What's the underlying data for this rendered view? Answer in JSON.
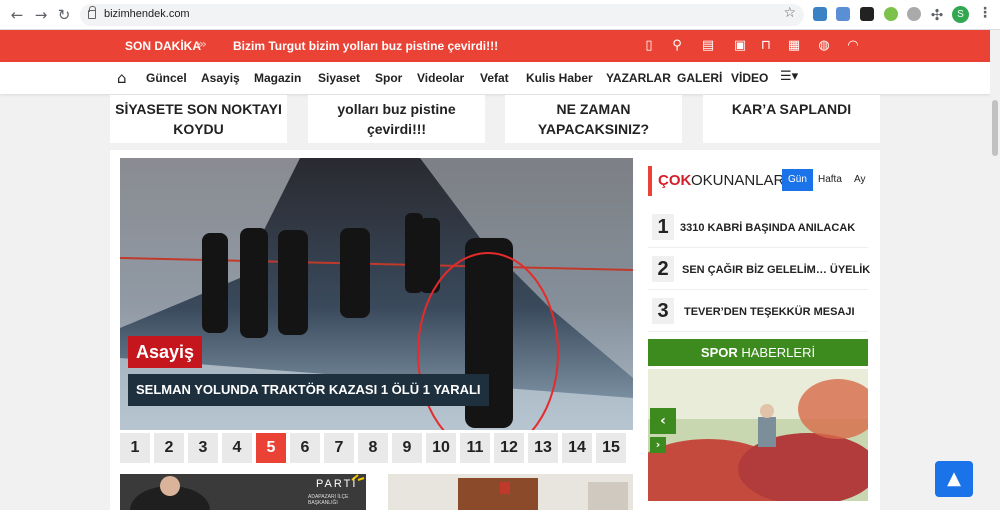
{
  "browser": {
    "url": "bizimhendek.com",
    "profile_initial": "S",
    "icons": [
      "back-icon",
      "forward-icon",
      "reload-icon",
      "lock-icon",
      "star-icon",
      "extension-icons",
      "puzzle-icon",
      "menu-dots-icon"
    ]
  },
  "ticker": {
    "label": "SON DAKİKA",
    "arrows": "›››",
    "headline": "Bizim Turgut bizim yolları buz pistine çevirdi!!!",
    "icons": [
      "mobile-icon",
      "search-icon",
      "id-card-icon",
      "briefcase-icon",
      "bookmark-icon",
      "keyboard-icon",
      "globe-icon",
      "rss-icon"
    ],
    "color": "#ea4335"
  },
  "menu": {
    "items": [
      "Güncel",
      "Asayiş",
      "Magazin",
      "Siyaset",
      "Spor",
      "Videolar",
      "Vefat",
      "Kulis Haber",
      "YAZARLAR",
      "GALERİ",
      "VİDEO"
    ]
  },
  "top_cards": [
    {
      "line1": "SİYASETE SON NOKTAYI",
      "line2": "KOYDU"
    },
    {
      "line1": "yolları buz pistine",
      "line2": "çevirdi!!!"
    },
    {
      "line1": "NE ZAMAN",
      "line2": "YAPACAKSINIZ?"
    },
    {
      "line1": "KAR’A SAPLANDI",
      "line2": ""
    }
  ],
  "slider": {
    "category": "Asayiş",
    "headline": "SELMAN YOLUNDA TRAKTÖR KAZASI 1 ÖLÜ 1 YARALI",
    "pages": [
      "1",
      "2",
      "3",
      "4",
      "5",
      "6",
      "7",
      "8",
      "9",
      "10",
      "11",
      "12",
      "13",
      "14",
      "15"
    ],
    "active_page": "5"
  },
  "thumbs": {
    "left_caption": "PARTİ",
    "left_subcaption": "ADAPAZARI İLÇE BAŞKANLIĞI"
  },
  "most_read": {
    "title_bold": "ÇOK",
    "title_rest": "OKUNANLAR",
    "tabs": [
      "Gün",
      "Hafta",
      "Ay"
    ],
    "active_tab": "Gün",
    "items": [
      {
        "rank": "1",
        "title": "3310 KABRİ BAŞINDA ANILACAK"
      },
      {
        "rank": "2",
        "title": "SEN ÇAĞIR BİZ GELELİM… ÜYELİK"
      },
      {
        "rank": "3",
        "title": "TEVER’DEN TEŞEKKÜR MESAJI"
      }
    ]
  },
  "sports": {
    "title_bold": "SPOR",
    "title_rest": "HABERLERİ",
    "prev": "‹",
    "next": "›",
    "color": "#3d8a1e"
  },
  "scroll_top": "▲"
}
